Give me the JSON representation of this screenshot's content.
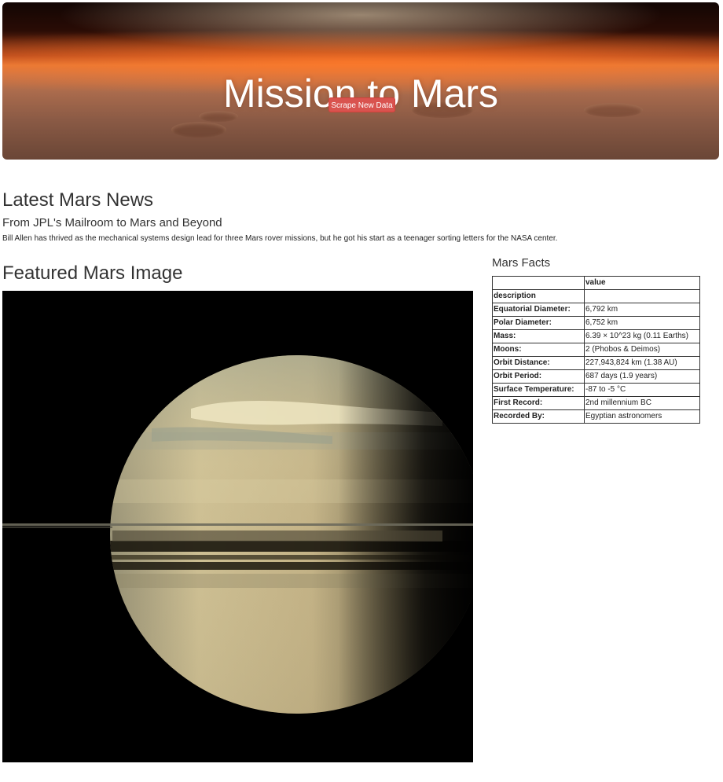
{
  "header": {
    "title": "Mission to Mars",
    "scrape_button": "Scrape New Data"
  },
  "news": {
    "heading": "Latest Mars News",
    "title": "From JPL's Mailroom to Mars and Beyond",
    "teaser": "Bill Allen has thrived as the mechanical systems design lead for three Mars rover missions, but he got his start as a teenager sorting letters for the NASA center."
  },
  "featured_image": {
    "heading": "Featured Mars Image"
  },
  "facts": {
    "heading": "Mars Facts",
    "columns": [
      "",
      "value"
    ],
    "index_label": "description",
    "rows": [
      {
        "label": "Equatorial Diameter:",
        "value": "6,792 km"
      },
      {
        "label": "Polar Diameter:",
        "value": "6,752 km"
      },
      {
        "label": "Mass:",
        "value": "6.39 × 10^23 kg (0.11 Earths)"
      },
      {
        "label": "Moons:",
        "value": "2 (Phobos & Deimos)"
      },
      {
        "label": "Orbit Distance:",
        "value": "227,943,824 km (1.38 AU)"
      },
      {
        "label": "Orbit Period:",
        "value": "687 days (1.9 years)"
      },
      {
        "label": "Surface Temperature:",
        "value": "-87 to -5 °C"
      },
      {
        "label": "First Record:",
        "value": "2nd millennium BC"
      },
      {
        "label": "Recorded By:",
        "value": "Egyptian astronomers"
      }
    ]
  }
}
